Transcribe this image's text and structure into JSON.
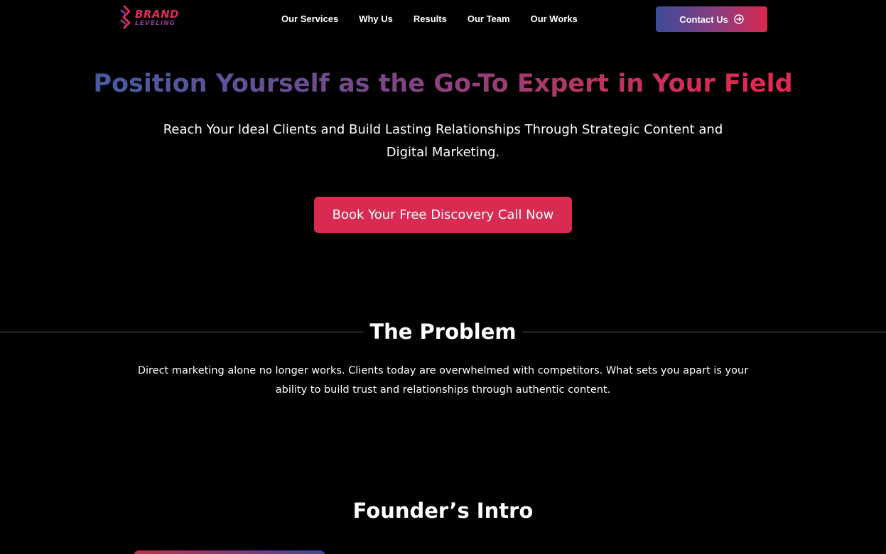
{
  "brand": {
    "name_line1": "BRAND",
    "name_line2": "LEVELING",
    "colors": {
      "primary": "#e02a5a",
      "secondary": "#8a3a9a",
      "blue": "#3c4a99"
    }
  },
  "nav": {
    "items": [
      {
        "label": "Our Services"
      },
      {
        "label": "Why Us"
      },
      {
        "label": "Results"
      },
      {
        "label": "Our Team"
      },
      {
        "label": "Our Works"
      }
    ],
    "contact": {
      "label": "Contact Us",
      "icon": "arrow-right-circle-icon"
    }
  },
  "hero": {
    "title": "Position Yourself as the Go-To Expert in Your Field",
    "subtitle": "Reach Your Ideal Clients and Build Lasting Relationships Through Strategic Content and Digital Marketing.",
    "cta_label": "Book Your Free Discovery Call Now",
    "cta_color": "#d92b52"
  },
  "problem": {
    "title": "The Problem",
    "text": "Direct marketing alone no longer works. Clients today are overwhelmed with competitors. What sets you apart is your ability to build trust and relationships through authentic content."
  },
  "founder": {
    "title": "Founder’s Intro"
  }
}
